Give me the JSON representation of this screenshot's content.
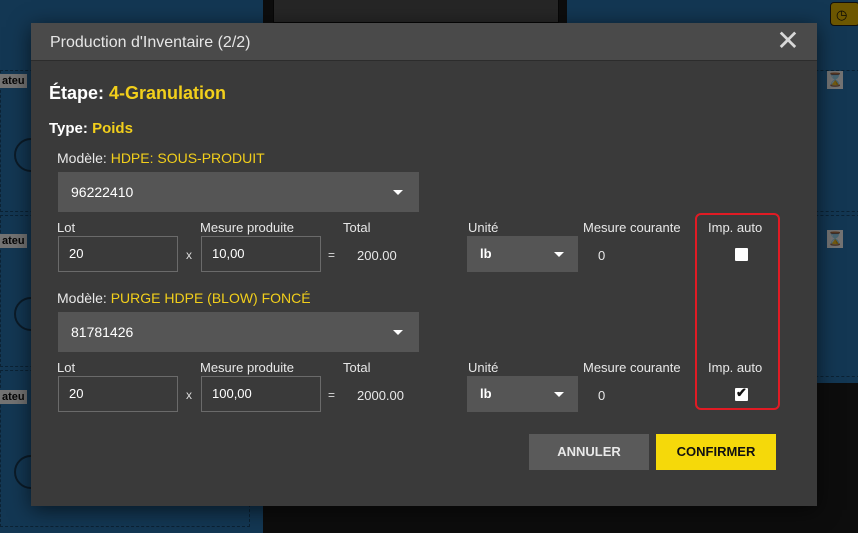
{
  "background": {
    "cell_label": "ateu",
    "hourglass_icon": "⌛",
    "clock_icon": "◷"
  },
  "modal": {
    "title": "Production d'Inventaire (2/2)",
    "close_icon": "✕",
    "step_label": "Étape:",
    "step_value": "4-Granulation",
    "type_label": "Type:",
    "type_value": "Poids",
    "products": [
      {
        "model_label": "Modèle:",
        "model_value": "HDPE: SOUS-PRODUIT",
        "selected_code": "96222410",
        "lot_label": "Lot",
        "lot_value": "20",
        "times": "x",
        "measure_label": "Mesure produite",
        "measure_value": "10,00",
        "equals": "=",
        "total_label": "Total",
        "total_value": "200.00",
        "unit_label": "Unité",
        "unit_value": "lb",
        "current_label": "Mesure courante",
        "current_value": "0",
        "auto_label": "Imp. auto",
        "auto_checked": false
      },
      {
        "model_label": "Modèle:",
        "model_value": "PURGE HDPE (BLOW) FONCÉ",
        "selected_code": "81781426",
        "lot_label": "Lot",
        "lot_value": "20",
        "times": "x",
        "measure_label": "Mesure produite",
        "measure_value": "100,00",
        "equals": "=",
        "total_label": "Total",
        "total_value": "2000.00",
        "unit_label": "Unité",
        "unit_value": "lb",
        "current_label": "Mesure courante",
        "current_value": "0",
        "auto_label": "Imp. auto",
        "auto_checked": true,
        "checkmark": "✔"
      }
    ],
    "cancel_label": "ANNULER",
    "confirm_label": "CONFIRMER"
  },
  "colors": {
    "accent": "#f2cf1b",
    "confirm": "#f5d90a",
    "highlight": "#e01b24"
  }
}
